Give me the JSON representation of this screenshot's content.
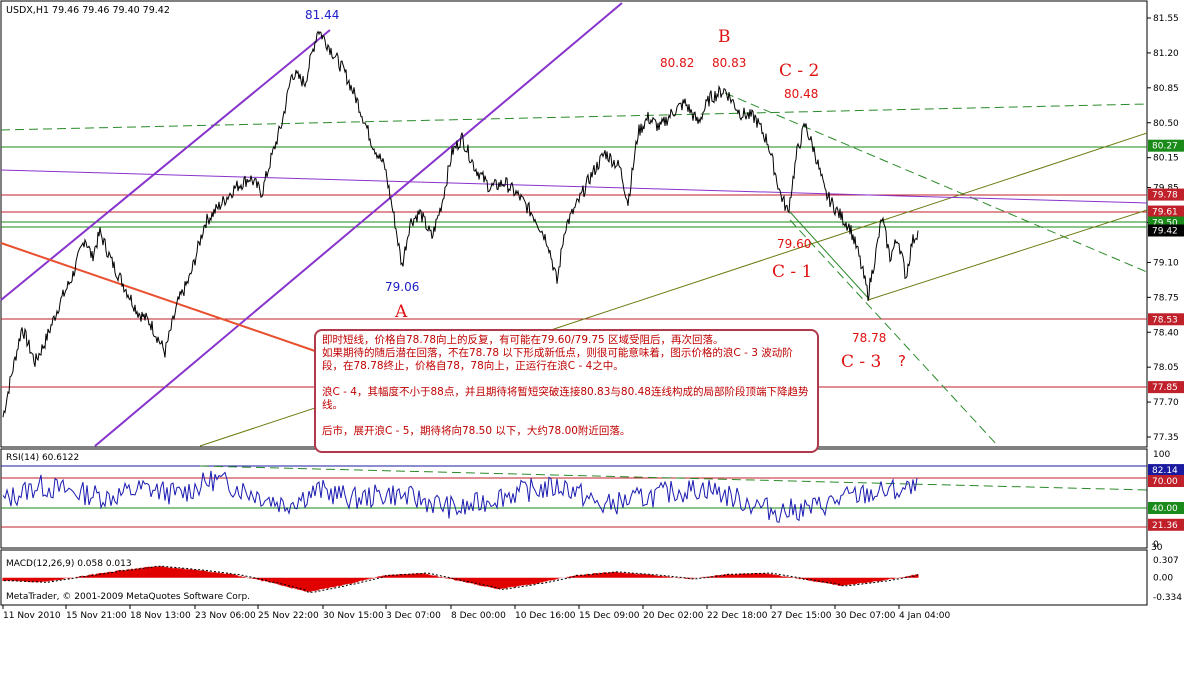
{
  "header": {
    "symbol_line": "USDX,H1  79.46 79.46 79.40 79.42",
    "rsi_label": "RSI(14) 60.6122",
    "macd_label": "MACD(12,26,9) 0.058 0.013",
    "copyright": "MetaTrader, © 2001-2009 MetaQuotes Software Corp."
  },
  "wave_labels": {
    "high_8144": "81.44",
    "low_7906": "79.06",
    "wave_a": "A",
    "wave_b": "B",
    "val_8082": "80.82",
    "val_8083": "80.83",
    "wave_c2": "C - 2",
    "val_8048": "80.48",
    "val_7960": "79.60",
    "wave_c1": "C - 1",
    "val_7878": "78.78",
    "wave_c3": "C - 3",
    "question": "?"
  },
  "note": {
    "line1": "即时短线，价格自78.78向上的反复，有可能在79.60/79.75 区域受阻后，再次回落。",
    "line2": "如果期待的随后潜在回落，不在78.78 以下形成新低点，则很可能意味着，图示价格的浪C - 3 波动阶段，在78.78终止，价格自78，78向上，正运行在浪C - 4之中。",
    "line3": "浪C - 4，其幅度不小于88点，并且期待将暂短突破连接80.83与80.48连线构成的局部阶段顶端下降趋势线。",
    "line4": "后市，展开浪C - 5，期待将向78.50 以下，大约78.00附近回落。"
  },
  "price_axis": {
    "ticks": [
      "81.55",
      "81.20",
      "80.85",
      "80.50",
      "80.15",
      "79.85",
      "79.50",
      "79.10",
      "78.75",
      "78.40",
      "78.05",
      "77.70",
      "77.35"
    ],
    "levels": [
      {
        "label": "80.27",
        "value": 80.27,
        "color": "#1a8a1a"
      },
      {
        "label": "79.78",
        "value": 79.78,
        "color": "#c0202a"
      },
      {
        "label": "79.61",
        "value": 79.61,
        "color": "#c0202a"
      },
      {
        "label": "79.50",
        "value": 79.5,
        "color": "#1a8a1a"
      },
      {
        "label": "79.42",
        "value": 79.42,
        "color": "#000000"
      },
      {
        "label": "78.53",
        "value": 78.53,
        "color": "#c0202a"
      },
      {
        "label": "77.85",
        "value": 77.85,
        "color": "#c0202a"
      }
    ]
  },
  "rsi_axis": {
    "ticks": [
      "100",
      "70.00",
      "40.00",
      "0"
    ],
    "levels": [
      {
        "label": "82.14",
        "value": 82.14,
        "color": "#1a1aa0"
      },
      {
        "label": "70.00",
        "value": 70.0,
        "color": "#c0202a"
      },
      {
        "label": "40.00",
        "value": 40.0,
        "color": "#1a8a1a"
      },
      {
        "label": "21.36",
        "value": 21.36,
        "color": "#c0202a"
      }
    ]
  },
  "macd_axis": {
    "ticks": [
      "0.307",
      "0.00",
      "-0.334"
    ],
    "top_value": "30"
  },
  "time_axis": [
    "11 Nov 2010",
    "15 Nov 21:00",
    "18 Nov 13:00",
    "23 Nov 06:00",
    "25 Nov 22:00",
    "30 Nov 15:00",
    "3 Dec 07:00",
    "8 Dec 00:00",
    "10 Dec 16:00",
    "15 Dec 09:00",
    "20 Dec 02:00",
    "22 Dec 18:00",
    "27 Dec 15:00",
    "30 Dec 07:00",
    "4 Jan 04:00"
  ],
  "chart_data": [
    {
      "type": "line",
      "title": "USDX,H1",
      "x": [
        "11 Nov 2010",
        "15 Nov 21:00",
        "18 Nov 13:00",
        "23 Nov 06:00",
        "25 Nov 22:00",
        "30 Nov 15:00",
        "3 Dec 07:00",
        "8 Dec 00:00",
        "10 Dec 16:00",
        "15 Dec 09:00",
        "20 Dec 02:00",
        "22 Dec 18:00",
        "27 Dec 15:00",
        "30 Dec 07:00",
        "4 Jan 04:00"
      ],
      "series": [
        {
          "values": [
            77.6,
            79.3,
            78.2,
            79.7,
            81.0,
            80.3,
            79.2,
            80.2,
            79.1,
            80.1,
            80.6,
            80.7,
            80.3,
            78.9,
            79.4
          ]
        }
      ],
      "key_points": [
        {
          "x": "25 Nov 22:00",
          "y": 81.44
        },
        {
          "x": "3 Dec 07:00",
          "y": 79.06
        },
        {
          "x": "22 Dec 18:00",
          "y": 80.83
        },
        {
          "x": "27 Dec 15:00",
          "y": 79.6
        },
        {
          "x": "30 Dec 07:00",
          "y": 78.78
        }
      ],
      "ylim": [
        77.25,
        81.65
      ],
      "grid": false,
      "colors": {
        "price": "#000000",
        "channel": "#8833cc",
        "support": "#6b7a10",
        "trend_down": "#2a8a2a",
        "fan": "#e85030"
      }
    },
    {
      "type": "line",
      "title": "RSI(14)",
      "series": [
        {
          "values": [
            48,
            65,
            58,
            52,
            62,
            55,
            72,
            58,
            44,
            60,
            50,
            56,
            48,
            38,
            52,
            60,
            64,
            42,
            50,
            58,
            62,
            48,
            36,
            40,
            52,
            58,
            60.6
          ]
        }
      ],
      "ylim": [
        0,
        100
      ],
      "colors": {
        "line": "#1a1ab0"
      }
    },
    {
      "type": "bar",
      "title": "MACD(12,26,9)",
      "series": [
        {
          "values": [
            -0.05,
            -0.08,
            0.02,
            0.12,
            0.2,
            0.14,
            0.06,
            -0.08,
            -0.25,
            -0.12,
            0.04,
            0.08,
            -0.06,
            -0.2,
            -0.1,
            0.04,
            0.1,
            0.05,
            -0.02,
            0.06,
            0.08,
            -0.03,
            -0.14,
            -0.06,
            0.058
          ]
        }
      ],
      "ylim": [
        -0.334,
        0.307
      ],
      "colors": {
        "bar": "#e00000",
        "signal": "#000000"
      }
    }
  ]
}
